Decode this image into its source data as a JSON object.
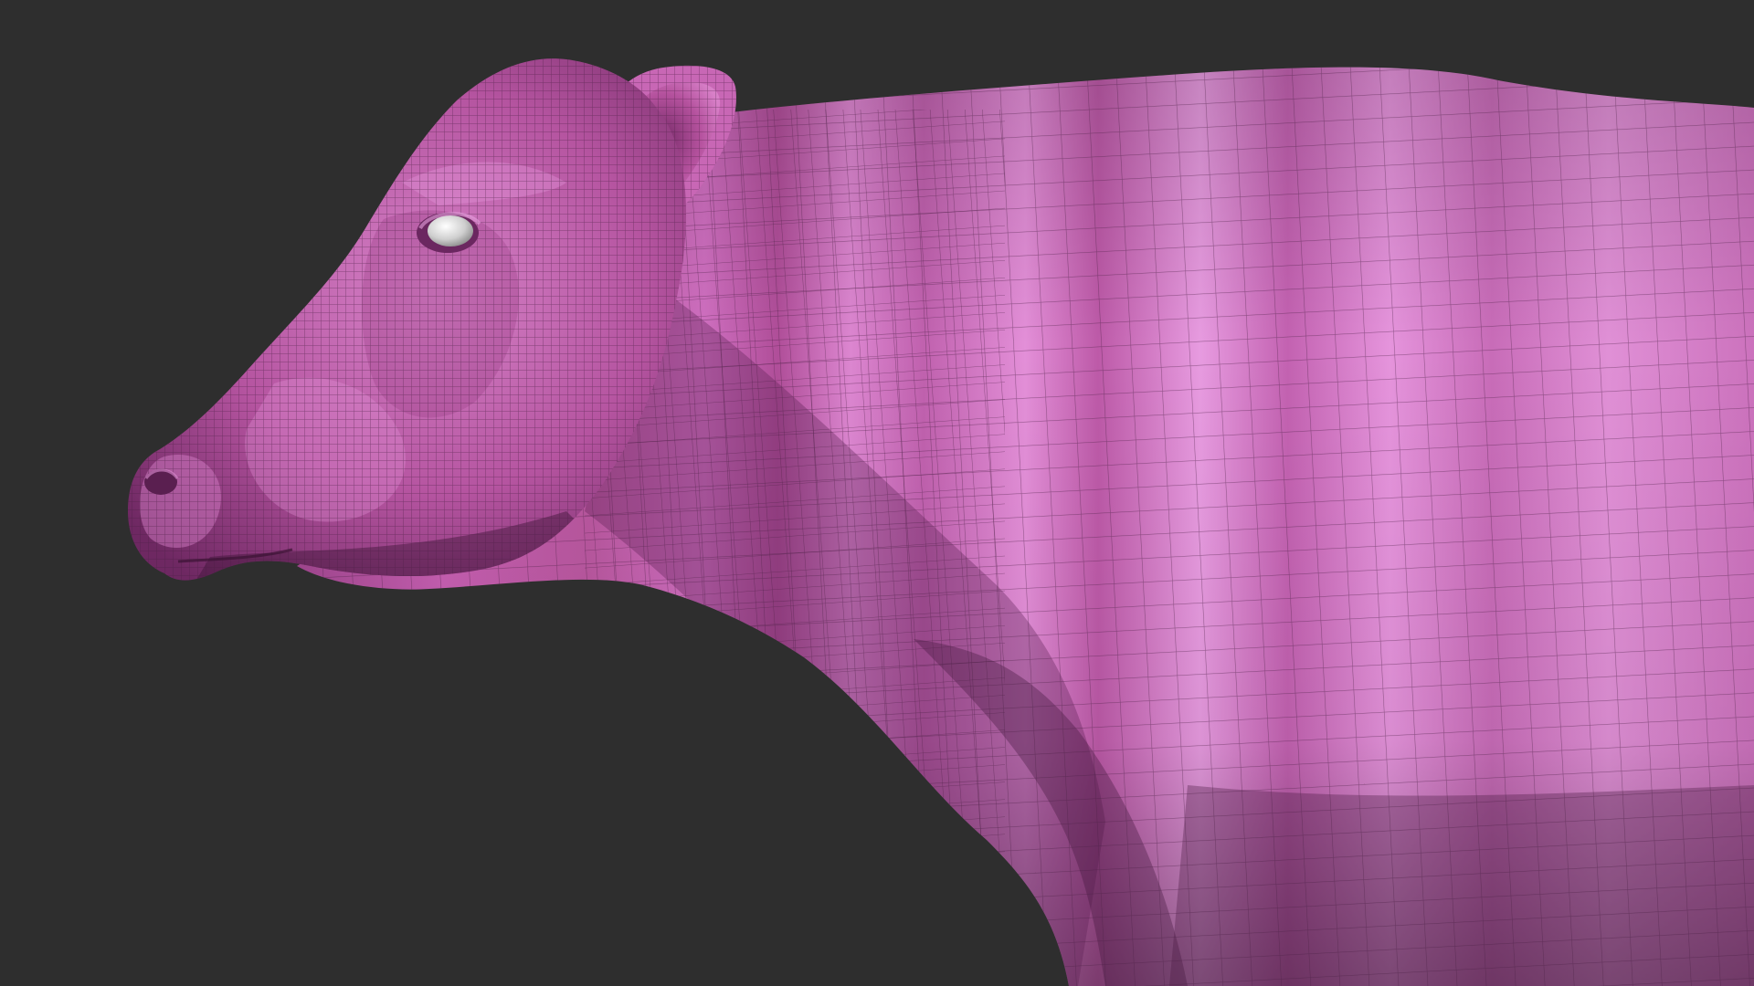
{
  "viewport": {
    "background_color": "#2e2e2e",
    "model_color": "#c25aa9",
    "model_highlight_color": "#e79be0",
    "model_shadow_color": "#6e2862",
    "wireframe_color": "#4a1f43",
    "eye_color": "#d8d8d8"
  },
  "model": {
    "subject": "cow",
    "view": "left-side",
    "display": "sculpt-with-polyframe-wireframe"
  }
}
